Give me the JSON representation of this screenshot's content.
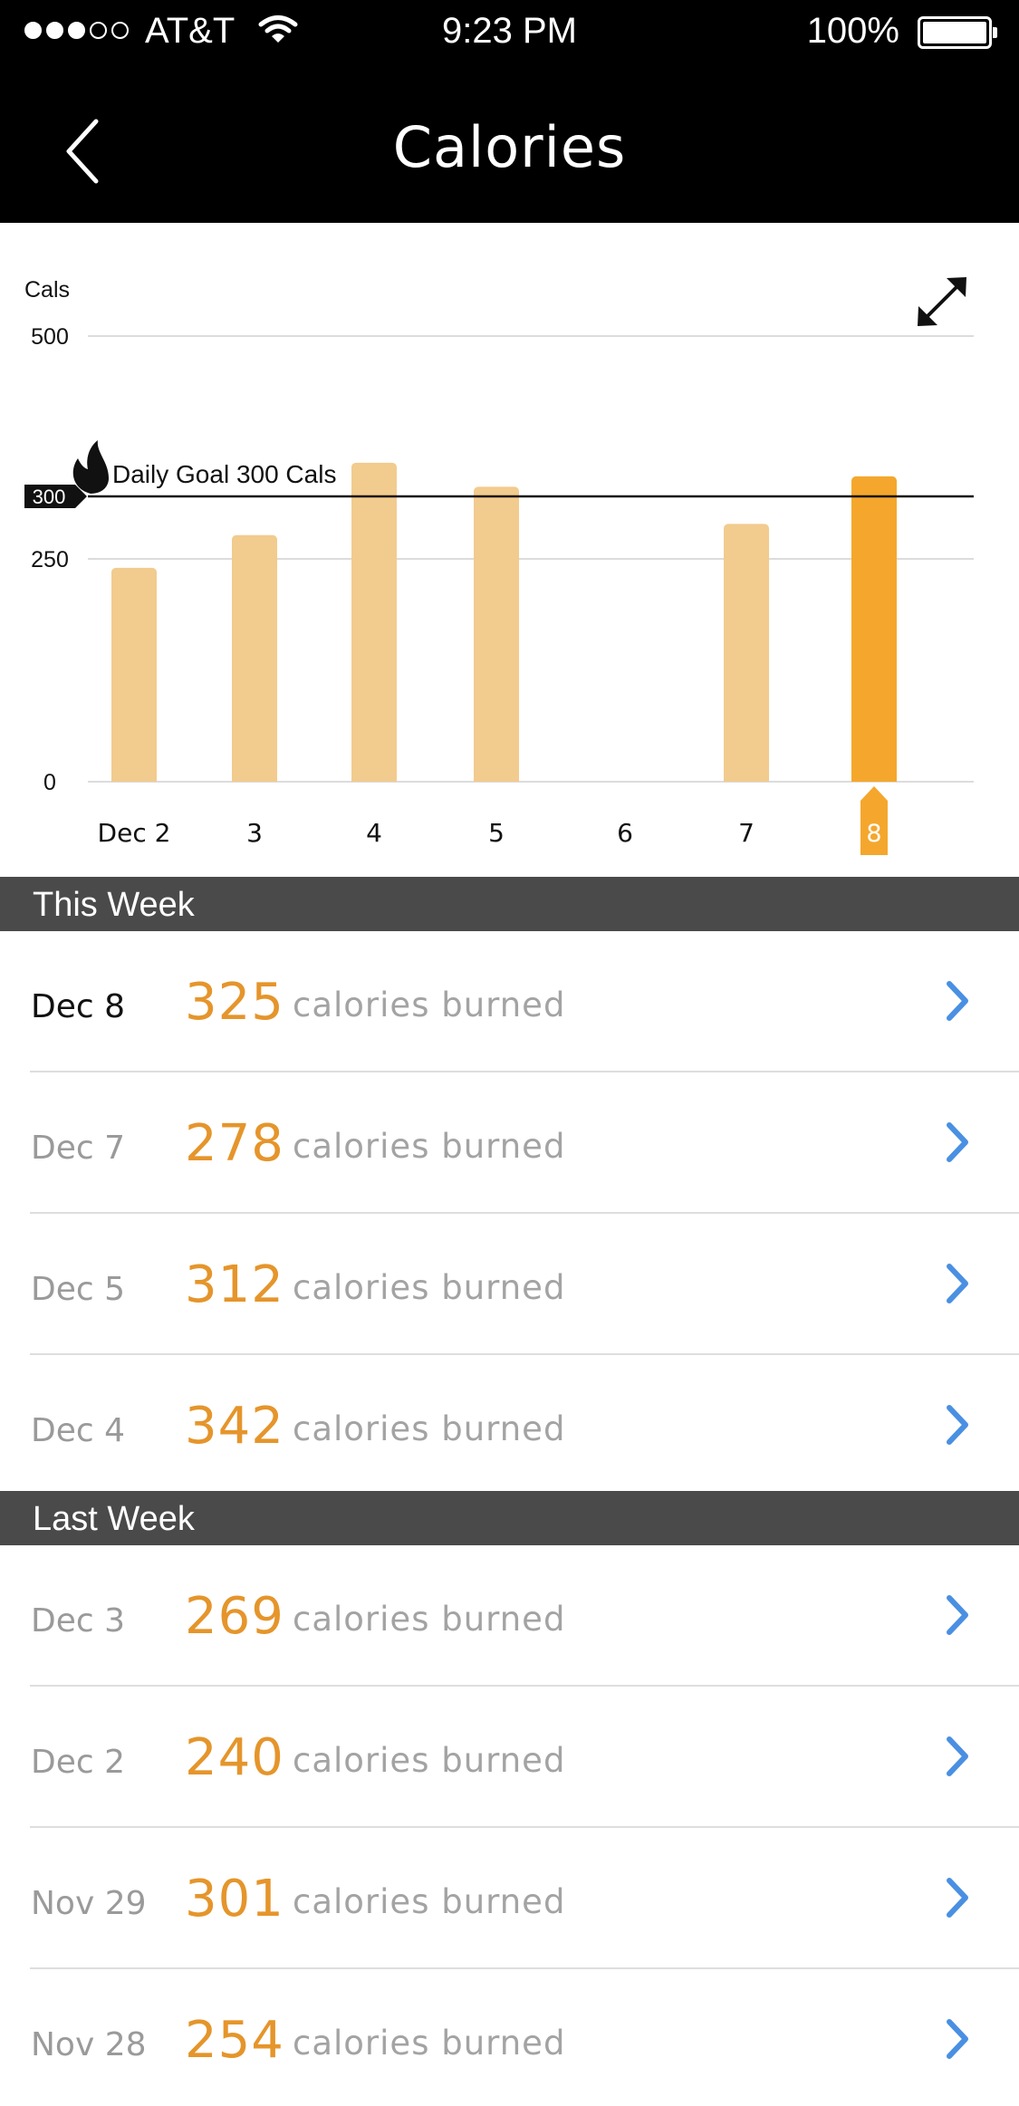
{
  "status_bar": {
    "carrier": "AT&T",
    "time": "9:23 PM",
    "battery": "100%",
    "signal_bars": 3
  },
  "nav": {
    "title": "Calories",
    "back_icon": "chevron-left-icon",
    "expand_icon": "expand-arrows-icon"
  },
  "colors": {
    "accent": "#f4a72c",
    "accent_light": "#f2cb8e",
    "value_text": "#e5952b",
    "chevron": "#4a90e2",
    "section_bg": "#4a4a4a"
  },
  "chart_data": {
    "type": "bar",
    "ylabel": "Cals",
    "y_ticks": [
      0,
      250,
      500
    ],
    "categories": [
      "Dec 2",
      "3",
      "4",
      "5",
      "6",
      "7",
      "8"
    ],
    "values": [
      240,
      269,
      342,
      312,
      0,
      278,
      325
    ],
    "selected_index": 6,
    "ylim": [
      0,
      500
    ],
    "goal": {
      "value": 300,
      "label": "Daily Goal 300 Cals",
      "tag": "300"
    },
    "grid": true
  },
  "sections": [
    {
      "title": "This Week",
      "rows": [
        {
          "date": "Dec 8",
          "value": "325",
          "label": "calories burned",
          "current": true
        },
        {
          "date": "Dec 7",
          "value": "278",
          "label": "calories burned"
        },
        {
          "date": "Dec 5",
          "value": "312",
          "label": "calories burned"
        },
        {
          "date": "Dec 4",
          "value": "342",
          "label": "calories burned"
        }
      ]
    },
    {
      "title": "Last Week",
      "rows": [
        {
          "date": "Dec 3",
          "value": "269",
          "label": "calories burned"
        },
        {
          "date": "Dec 2",
          "value": "240",
          "label": "calories burned"
        },
        {
          "date": "Nov 29",
          "value": "301",
          "label": "calories burned"
        },
        {
          "date": "Nov 28",
          "value": "254",
          "label": "calories burned"
        }
      ]
    }
  ]
}
